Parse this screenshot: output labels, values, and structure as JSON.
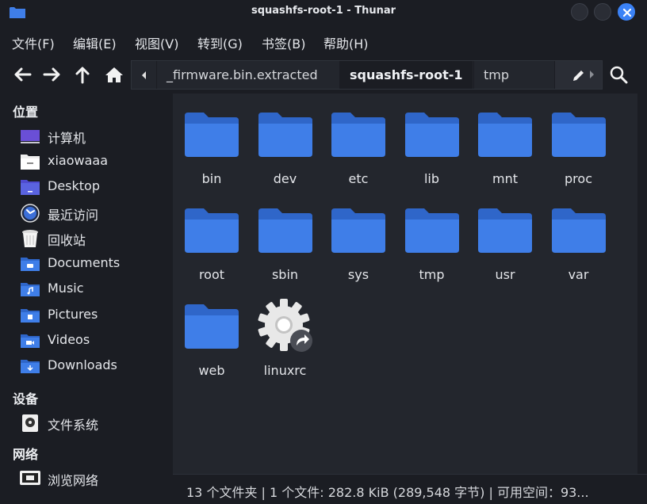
{
  "window": {
    "title": "squashfs-root-1 - Thunar"
  },
  "menu": [
    "文件(F)",
    "编辑(E)",
    "视图(V)",
    "转到(G)",
    "书签(B)",
    "帮助(H)"
  ],
  "pathbar": {
    "crumbs": [
      "_firmware.bin.extracted",
      "squashfs-root-1",
      "tmp"
    ],
    "active_index": 1
  },
  "sidebar": {
    "sections": [
      {
        "heading": "位置",
        "items": [
          {
            "label": "计算机",
            "icon": "computer-icon"
          },
          {
            "label": "xiaowaaa",
            "icon": "home-folder-icon"
          },
          {
            "label": "Desktop",
            "icon": "desktop-folder-icon"
          },
          {
            "label": "最近访问",
            "icon": "recent-icon"
          },
          {
            "label": "回收站",
            "icon": "trash-icon"
          },
          {
            "label": "Documents",
            "icon": "documents-folder-icon"
          },
          {
            "label": "Music",
            "icon": "music-folder-icon"
          },
          {
            "label": "Pictures",
            "icon": "pictures-folder-icon"
          },
          {
            "label": "Videos",
            "icon": "videos-folder-icon"
          },
          {
            "label": "Downloads",
            "icon": "downloads-folder-icon"
          }
        ]
      },
      {
        "heading": "设备",
        "items": [
          {
            "label": "文件系统",
            "icon": "drive-icon"
          }
        ]
      },
      {
        "heading": "网络",
        "items": [
          {
            "label": "浏览网络",
            "icon": "network-icon"
          }
        ]
      }
    ]
  },
  "files": [
    {
      "name": "bin",
      "type": "folder"
    },
    {
      "name": "dev",
      "type": "folder"
    },
    {
      "name": "etc",
      "type": "folder"
    },
    {
      "name": "lib",
      "type": "folder"
    },
    {
      "name": "mnt",
      "type": "folder"
    },
    {
      "name": "proc",
      "type": "folder"
    },
    {
      "name": "root",
      "type": "folder"
    },
    {
      "name": "sbin",
      "type": "folder"
    },
    {
      "name": "sys",
      "type": "folder"
    },
    {
      "name": "tmp",
      "type": "folder"
    },
    {
      "name": "usr",
      "type": "folder"
    },
    {
      "name": "var",
      "type": "folder"
    },
    {
      "name": "web",
      "type": "folder"
    },
    {
      "name": "linuxrc",
      "type": "symlink-executable"
    }
  ],
  "status": {
    "text": "13 个文件夹 | 1 个文件: 282.8 KiB (289,548 字节) | 可用空间：93..."
  },
  "colors": {
    "accent": "#3b82f6",
    "folder": "#3f7ee8",
    "folder_tab": "#2f66c9",
    "background": "#1b1d23",
    "content_bg": "#23262d"
  }
}
